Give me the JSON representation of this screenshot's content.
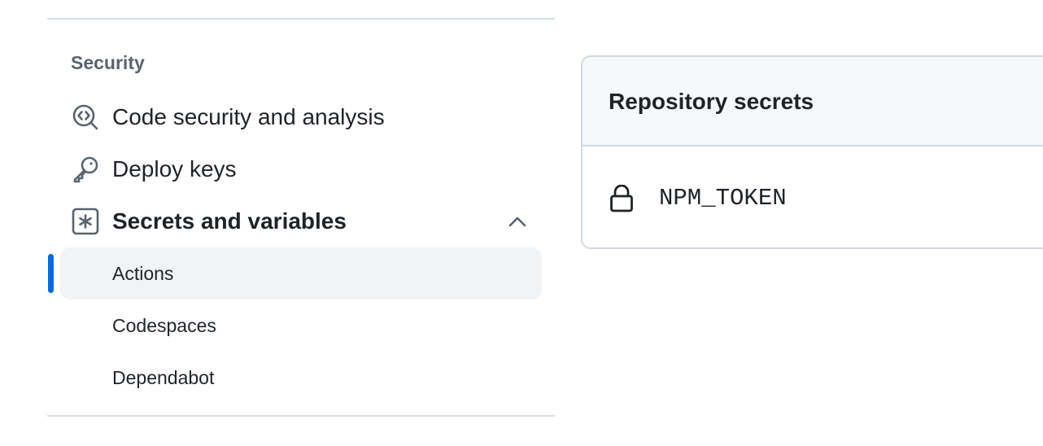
{
  "sidebar": {
    "section_heading": "Security",
    "items": [
      {
        "label": "Code security and analysis",
        "icon": "codescan-icon"
      },
      {
        "label": "Deploy keys",
        "icon": "key-icon"
      },
      {
        "label": "Secrets and variables",
        "icon": "asterisk-icon",
        "expanded": true
      }
    ],
    "subitems": [
      {
        "label": "Actions",
        "active": true
      },
      {
        "label": "Codespaces",
        "active": false
      },
      {
        "label": "Dependabot",
        "active": false
      }
    ]
  },
  "secrets_panel": {
    "title": "Repository secrets",
    "secrets": [
      {
        "name": "NPM_TOKEN",
        "icon": "lock-icon"
      }
    ]
  },
  "colors": {
    "accent": "#0969da",
    "active_bg": "#f2f3f5",
    "muted_text": "#59636e",
    "border": "#d1d9e0"
  }
}
